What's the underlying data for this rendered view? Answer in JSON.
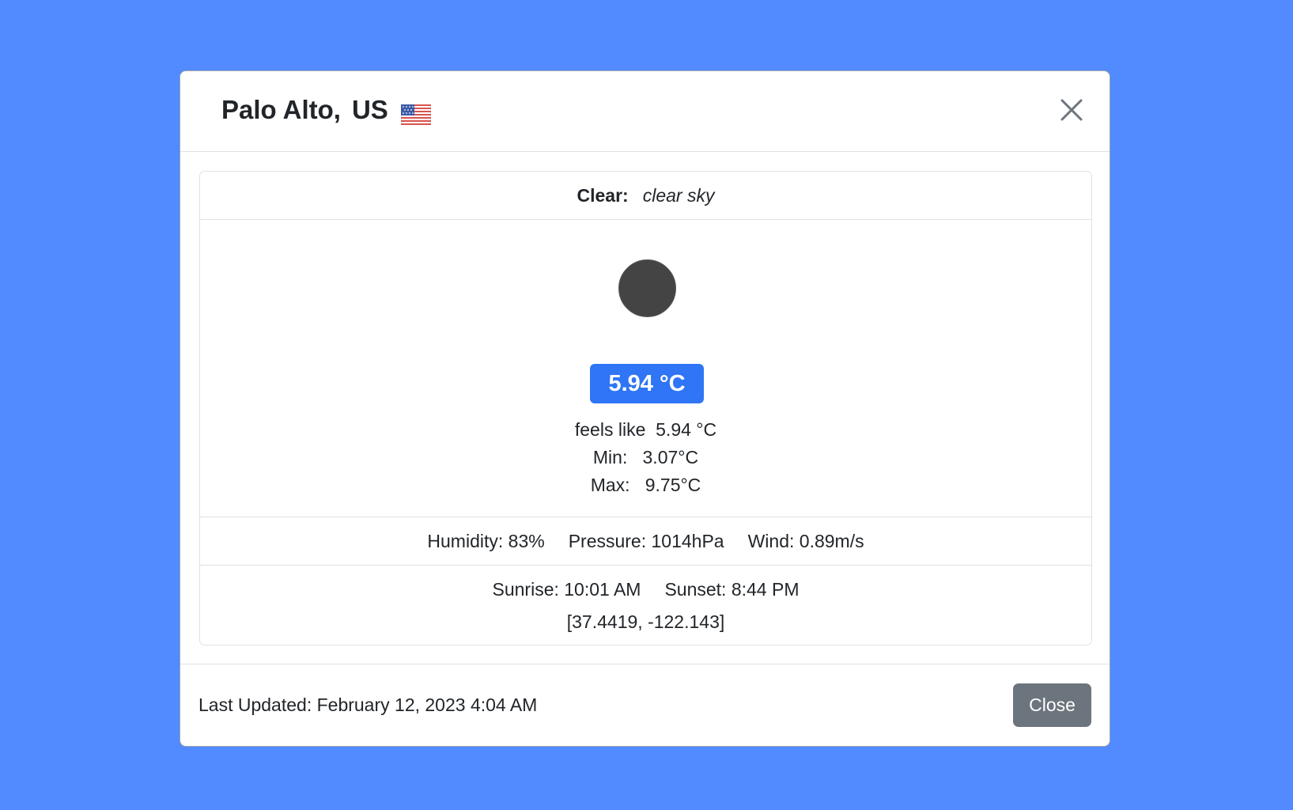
{
  "modal": {
    "city": "Palo Alto,",
    "country": "US",
    "flag_icon": "us-flag-icon",
    "close_icon": "close-icon"
  },
  "weather": {
    "condition": "Clear:",
    "description": "clear sky",
    "icon": "weather-clear-icon",
    "temperature": "5.94 °C",
    "feels_like": "feels like  5.94 °C",
    "min": "Min:   3.07°C",
    "max": "Max:   9.75°C"
  },
  "stats": {
    "humidity": "Humidity: 83%",
    "pressure": "Pressure: 1014hPa",
    "wind": "Wind: 0.89m/s"
  },
  "sun": {
    "sunrise": "Sunrise: 10:01 AM",
    "sunset": "Sunset: 8:44 PM",
    "coordinates": "[37.4419, -122.143]"
  },
  "footer": {
    "last_updated": "Last Updated: February 12, 2023 4:04 AM",
    "close_label": "Close"
  },
  "colors": {
    "background": "#528bff",
    "badge": "#2f75f5",
    "close_button": "#6c757d",
    "icon": "#444444"
  }
}
